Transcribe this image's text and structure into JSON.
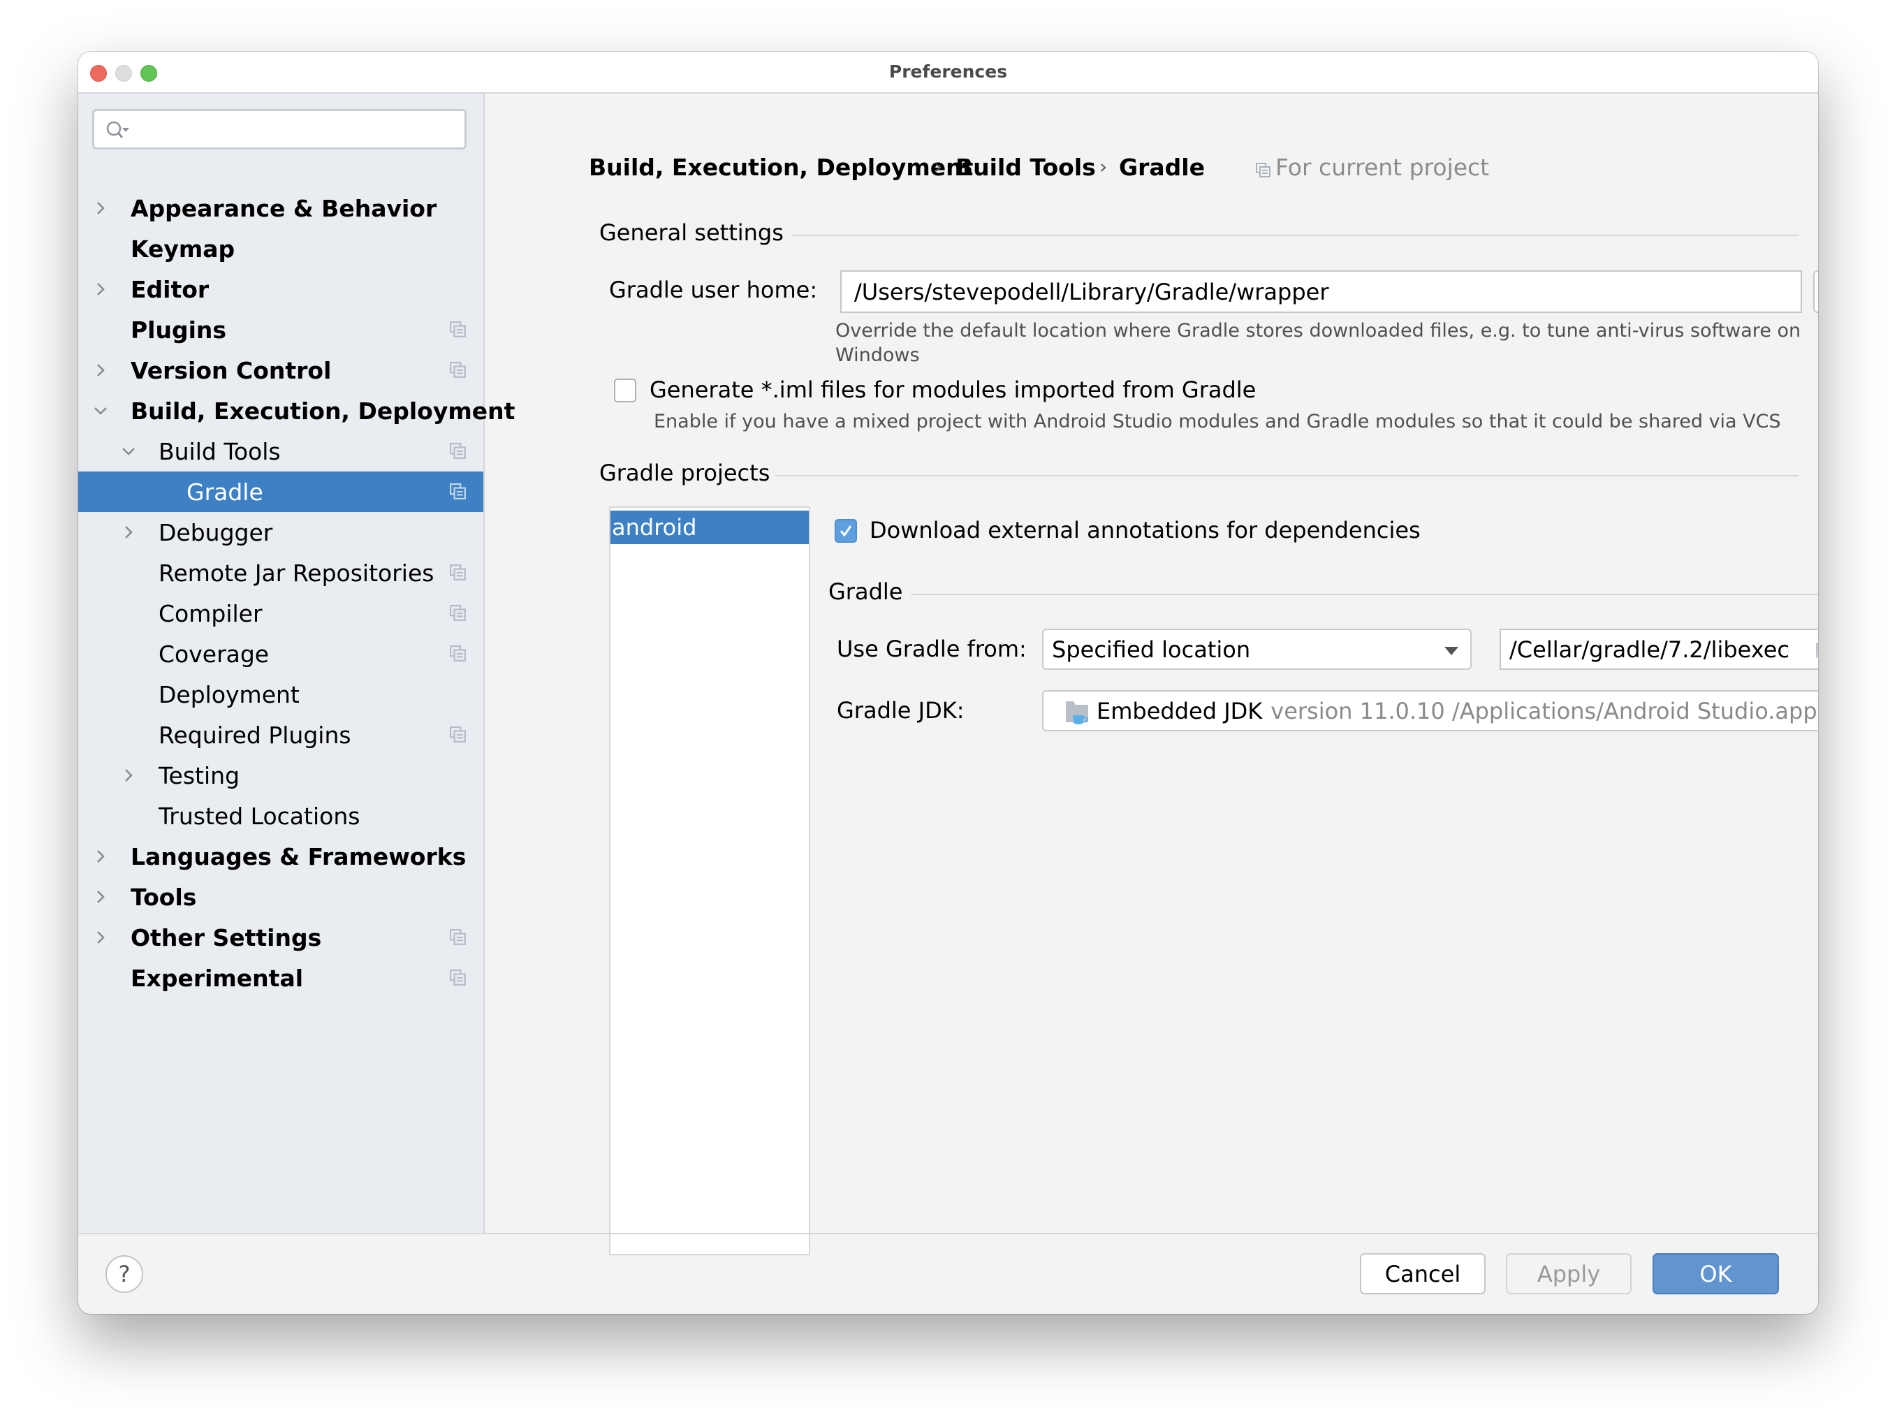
{
  "window": {
    "title": "Preferences"
  },
  "search": {
    "placeholder": "",
    "value": ""
  },
  "sidebar": {
    "items": [
      {
        "label": "Appearance & Behavior",
        "level": 0,
        "expandable": true,
        "expanded": false,
        "project_scope": false
      },
      {
        "label": "Keymap",
        "level": 0,
        "expandable": false,
        "project_scope": false
      },
      {
        "label": "Editor",
        "level": 0,
        "expandable": true,
        "expanded": false,
        "project_scope": false
      },
      {
        "label": "Plugins",
        "level": 0,
        "expandable": false,
        "project_scope": true
      },
      {
        "label": "Version Control",
        "level": 0,
        "expandable": true,
        "expanded": false,
        "project_scope": true
      },
      {
        "label": "Build, Execution, Deployment",
        "level": 0,
        "expandable": true,
        "expanded": true,
        "project_scope": false
      },
      {
        "label": "Build Tools",
        "level": 1,
        "expandable": true,
        "expanded": true,
        "project_scope": true
      },
      {
        "label": "Gradle",
        "level": 2,
        "expandable": false,
        "project_scope": true,
        "selected": true
      },
      {
        "label": "Debugger",
        "level": 1,
        "expandable": true,
        "expanded": false,
        "project_scope": false
      },
      {
        "label": "Remote Jar Repositories",
        "level": 1,
        "expandable": false,
        "project_scope": true
      },
      {
        "label": "Compiler",
        "level": 1,
        "expandable": false,
        "project_scope": true
      },
      {
        "label": "Coverage",
        "level": 1,
        "expandable": false,
        "project_scope": true
      },
      {
        "label": "Deployment",
        "level": 1,
        "expandable": false,
        "project_scope": false
      },
      {
        "label": "Required Plugins",
        "level": 1,
        "expandable": false,
        "project_scope": true
      },
      {
        "label": "Testing",
        "level": 1,
        "expandable": true,
        "expanded": false,
        "project_scope": false
      },
      {
        "label": "Trusted Locations",
        "level": 1,
        "expandable": false,
        "project_scope": false
      },
      {
        "label": "Languages & Frameworks",
        "level": 0,
        "expandable": true,
        "expanded": false,
        "project_scope": false
      },
      {
        "label": "Tools",
        "level": 0,
        "expandable": true,
        "expanded": false,
        "project_scope": false
      },
      {
        "label": "Other Settings",
        "level": 0,
        "expandable": true,
        "expanded": false,
        "project_scope": true
      },
      {
        "label": "Experimental",
        "level": 0,
        "expandable": false,
        "project_scope": true
      }
    ]
  },
  "breadcrumb": {
    "items": [
      "Build, Execution, Deployment",
      "Build Tools",
      "Gradle"
    ],
    "separator": "›",
    "scope_label": "For current project"
  },
  "general_settings": {
    "title": "General settings",
    "gradle_user_home_label": "Gradle user home:",
    "gradle_user_home_value": "/Users/stevepodell/Library/Gradle/wrapper",
    "browse_label": "...",
    "gradle_user_home_hint_line1": "Override the default location where Gradle stores downloaded files, e.g. to tune anti-virus software on",
    "gradle_user_home_hint_line2": "Windows",
    "generate_iml_label": "Generate *.iml files for modules imported from Gradle",
    "generate_iml_checked": false,
    "generate_iml_hint": "Enable if you have a mixed project with Android Studio modules and Gradle modules so that it could be shared via VCS"
  },
  "gradle_projects": {
    "title": "Gradle projects",
    "projects": [
      "android"
    ],
    "selected_project": "android",
    "download_annotations_label": "Download external annotations for dependencies",
    "download_annotations_checked": true,
    "gradle_section_title": "Gradle",
    "use_gradle_from_label": "Use Gradle from:",
    "use_gradle_from_value": "Specified location",
    "gradle_location_value": "/Cellar/gradle/7.2/libexec",
    "gradle_jdk_label": "Gradle JDK:",
    "gradle_jdk_name": "Embedded JDK",
    "gradle_jdk_detail": "version 11.0.10 /Applications/Android Studio.app"
  },
  "footer": {
    "help_label": "?",
    "cancel_label": "Cancel",
    "apply_label": "Apply",
    "ok_label": "OK",
    "apply_enabled": false
  },
  "colors": {
    "selection": "#3d80c4",
    "ok_button": "#6295d0",
    "checkbox_checked": "#5e9fe0",
    "sidebar_bg": "#e9ecf0",
    "content_bg": "#f3f3f3"
  }
}
